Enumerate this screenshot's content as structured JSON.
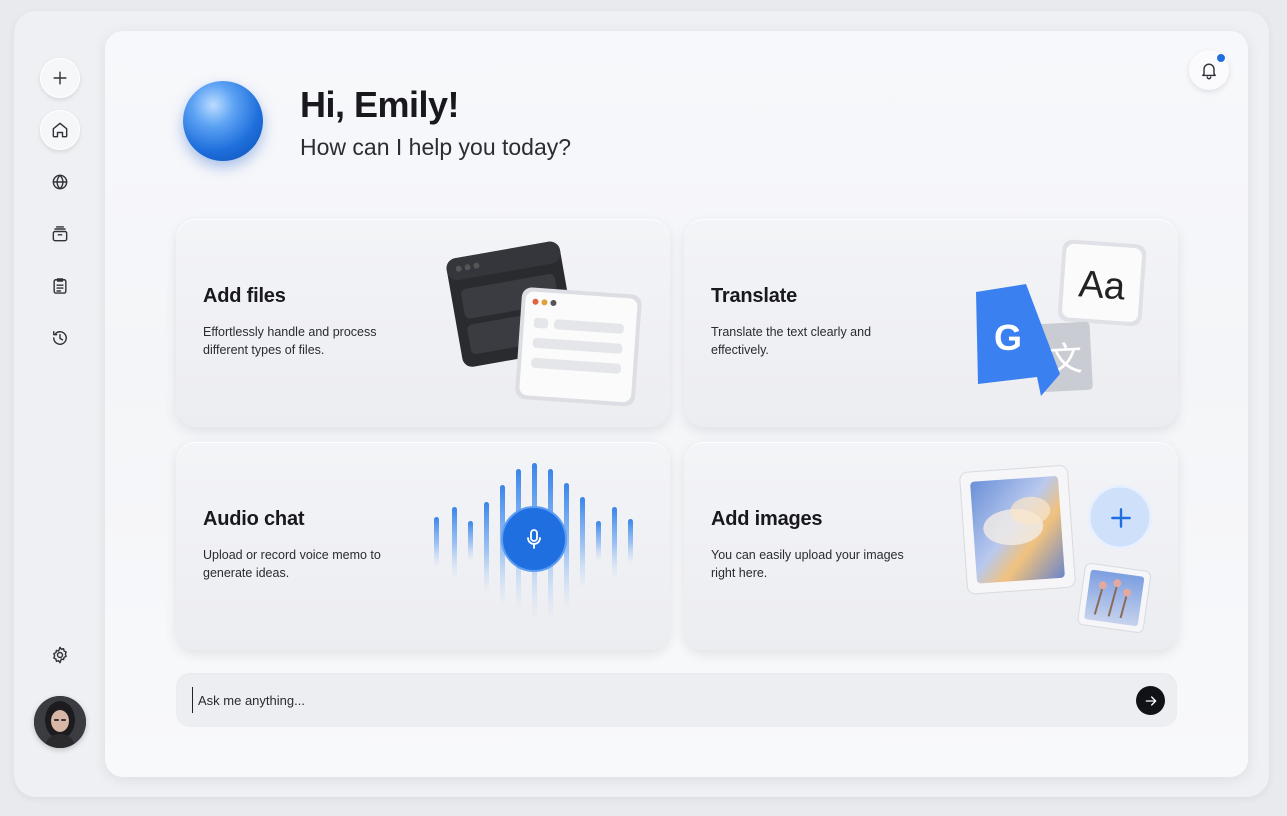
{
  "sidebar": {
    "items": [
      {
        "name": "new-chat",
        "icon": "plus-icon"
      },
      {
        "name": "home",
        "icon": "home-icon"
      },
      {
        "name": "explore",
        "icon": "globe-icon"
      },
      {
        "name": "archive",
        "icon": "archive-icon"
      },
      {
        "name": "notes",
        "icon": "clipboard-icon"
      },
      {
        "name": "history",
        "icon": "history-icon"
      }
    ],
    "settings_icon": "gear-icon",
    "avatar": "user-avatar"
  },
  "header": {
    "greeting": "Hi, Emily!",
    "subtitle": "How can I help you today?",
    "notification_icon": "bell-icon",
    "has_unread": true
  },
  "cards": [
    {
      "title": "Add files",
      "description": "Effortlessly handle and process different types of files."
    },
    {
      "title": "Translate",
      "description": "Translate the text clearly and effectively."
    },
    {
      "title": "Audio chat",
      "description": "Upload or record voice memo to generate ideas."
    },
    {
      "title": "Add images",
      "description": "You can easily upload your images right here."
    }
  ],
  "translate_badge": {
    "latin": "G",
    "glyph": "文",
    "sample": "Aa"
  },
  "composer": {
    "placeholder": "Ask me anything...",
    "send_icon": "arrow-right-icon"
  },
  "colors": {
    "accent": "#1f6fe0",
    "background": "#e9eaee",
    "surface": "#f7f8fb"
  }
}
